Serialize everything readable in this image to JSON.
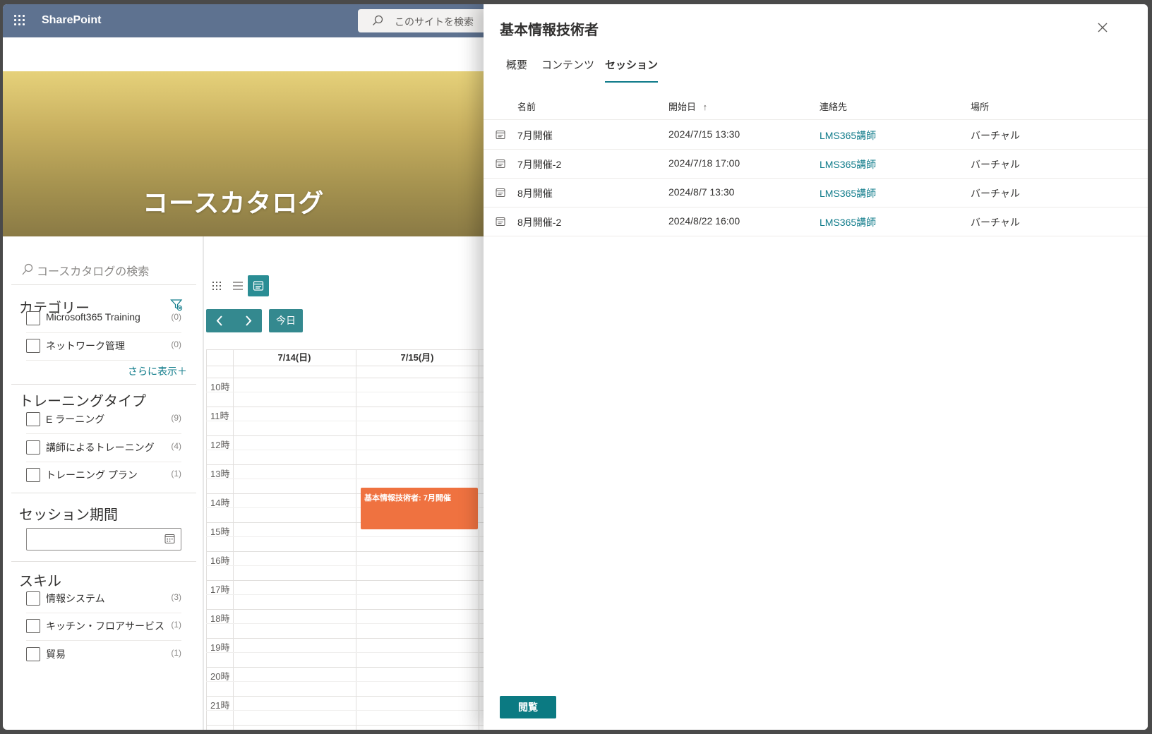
{
  "suitebar": {
    "brand": "SharePoint",
    "search_placeholder": "このサイトを検索"
  },
  "hero": {
    "title": "コースカタログ"
  },
  "filters": {
    "search_placeholder": "コースカタログの検索",
    "sections": {
      "category": {
        "title": "カテゴリー",
        "items": [
          {
            "label": "Microsoft365 Training",
            "count": "(0)"
          },
          {
            "label": "ネットワーク管理",
            "count": "(0)"
          }
        ],
        "more": "さらに表示＋"
      },
      "training_type": {
        "title": "トレーニングタイプ",
        "items": [
          {
            "label": "E ラーニング",
            "count": "(9)"
          },
          {
            "label": "講師によるトレーニング",
            "count": "(4)"
          },
          {
            "label": "トレーニング プラン",
            "count": "(1)"
          }
        ]
      },
      "session_period": {
        "title": "セッション期間"
      },
      "skill": {
        "title": "スキル",
        "items": [
          {
            "label": "情報システム",
            "count": "(3)"
          },
          {
            "label": "キッチン・フロアサービス",
            "count": "(1)"
          },
          {
            "label": "貿易",
            "count": "(1)"
          }
        ]
      }
    }
  },
  "calendar": {
    "today_label": "今日",
    "prev_icon": "chevron-left-icon",
    "next_icon": "chevron-right-icon",
    "days": [
      "7/14(日)",
      "7/15(月)"
    ],
    "hours": [
      "10時",
      "11時",
      "12時",
      "13時",
      "14時",
      "15時",
      "16時",
      "17時",
      "18時",
      "19時",
      "20時",
      "21時"
    ],
    "event": {
      "title": "基本情報技術者: 7月開催",
      "color": "#ef7240"
    }
  },
  "panel": {
    "title": "基本情報技術者",
    "tabs": [
      {
        "label": "概要",
        "active": false
      },
      {
        "label": "コンテンツ",
        "active": false
      },
      {
        "label": "セッション",
        "active": true
      }
    ],
    "columns": {
      "name": "名前",
      "start": "開始日",
      "contact": "連絡先",
      "location": "場所"
    },
    "sort_indicator": "↑",
    "rows": [
      {
        "name": "7月開催",
        "start": "2024/7/15 13:30",
        "contact": "LMS365講師",
        "location": "バーチャル"
      },
      {
        "name": "7月開催-2",
        "start": "2024/7/18 17:00",
        "contact": "LMS365講師",
        "location": "バーチャル"
      },
      {
        "name": "8月開催",
        "start": "2024/8/7 13:30",
        "contact": "LMS365講師",
        "location": "バーチャル"
      },
      {
        "name": "8月開催-2",
        "start": "2024/8/22 16:00",
        "contact": "LMS365講師",
        "location": "バーチャル"
      }
    ],
    "view_button": "閲覧"
  },
  "colors": {
    "accent": "#0f7b8a",
    "suitebar": "#5e7290",
    "event": "#ef7240"
  }
}
